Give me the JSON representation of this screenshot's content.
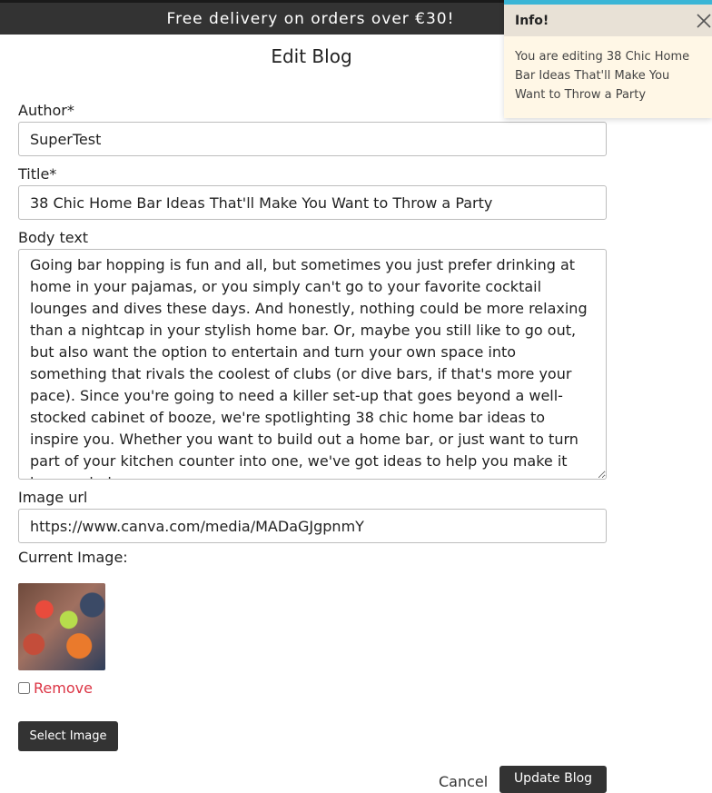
{
  "banner": {
    "text": "Free delivery on orders over €30!"
  },
  "page": {
    "title": "Edit Blog"
  },
  "form": {
    "author": {
      "label": "Author*",
      "value": "SuperTest"
    },
    "title": {
      "label": "Title*",
      "value": "38 Chic Home Bar Ideas That'll Make You Want to Throw a Party"
    },
    "body": {
      "label": "Body text",
      "value": "Going bar hopping is fun and all, but sometimes you just prefer drinking at home in your pajamas, or you simply can't go to your favorite cocktail lounges and dives these days. And honestly, nothing could be more relaxing than a nightcap in your stylish home bar. Or, maybe you still like to go out, but also want the option to entertain and turn your own space into something that rivals the coolest of clubs (or dive bars, if that's more your pace). Since you're going to need a killer set-up that goes beyond a well-stocked cabinet of booze, we're spotlighting 38 chic home bar ideas to inspire you. Whether you want to build out a home bar, or just want to turn part of your kitchen counter into one, we've got ideas to help you make it happen below."
    },
    "image_url": {
      "label": "Image url",
      "value": "https://www.canva.com/media/MADaGJgpnmY"
    },
    "current_image_label": "Current Image:",
    "remove_label": "Remove",
    "select_image_label": "Select Image",
    "cancel_label": "Cancel",
    "update_label": "Update Blog"
  },
  "toast": {
    "title": "Info!",
    "message": "You are editing 38 Chic Home Bar Ideas That'll Make You Want to Throw a Party",
    "accent_color": "#3ab5d6"
  },
  "colors": {
    "dark_button": "#333333",
    "remove_text": "#dc3545"
  }
}
